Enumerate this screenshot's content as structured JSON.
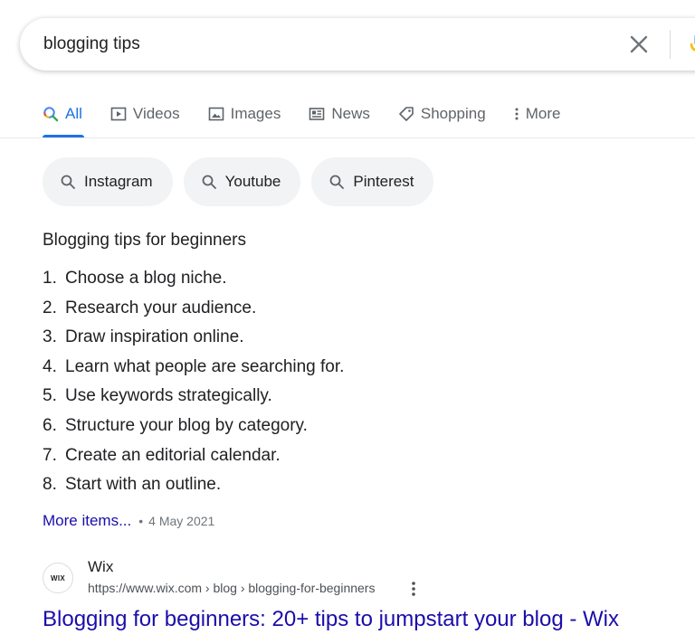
{
  "search": {
    "query": "blogging tips"
  },
  "tabs": [
    {
      "label": "All",
      "icon": "search-icon",
      "active": true
    },
    {
      "label": "Videos",
      "icon": "play-icon"
    },
    {
      "label": "Images",
      "icon": "image-icon"
    },
    {
      "label": "News",
      "icon": "news-icon"
    },
    {
      "label": "Shopping",
      "icon": "tag-icon"
    },
    {
      "label": "More",
      "icon": "more-vert-icon"
    }
  ],
  "chips": [
    {
      "label": "Instagram"
    },
    {
      "label": "Youtube"
    },
    {
      "label": "Pinterest"
    }
  ],
  "snippet": {
    "title": "Blogging tips for beginners",
    "items": [
      {
        "num": "1.",
        "text": "Choose a blog niche."
      },
      {
        "num": "2.",
        "text": "Research your audience."
      },
      {
        "num": "3.",
        "text": "Draw inspiration online."
      },
      {
        "num": "4.",
        "text": "Learn what people are searching for."
      },
      {
        "num": "5.",
        "text": "Use keywords strategically."
      },
      {
        "num": "6.",
        "text": "Structure your blog by category."
      },
      {
        "num": "7.",
        "text": "Create an editorial calendar."
      },
      {
        "num": "8.",
        "text": "Start with an outline."
      }
    ],
    "more_label": "More items...",
    "separator": "•",
    "date": "4 May 2021"
  },
  "result": {
    "favicon_text": "WIX",
    "site_name": "Wix",
    "url": "https://www.wix.com › blog › blogging-for-beginners",
    "title": "Blogging for beginners: 20+ tips to jumpstart your blog - Wix"
  },
  "colors": {
    "accent": "#1a73e8",
    "link": "#1a0dab",
    "chip_bg": "#f1f3f4"
  }
}
